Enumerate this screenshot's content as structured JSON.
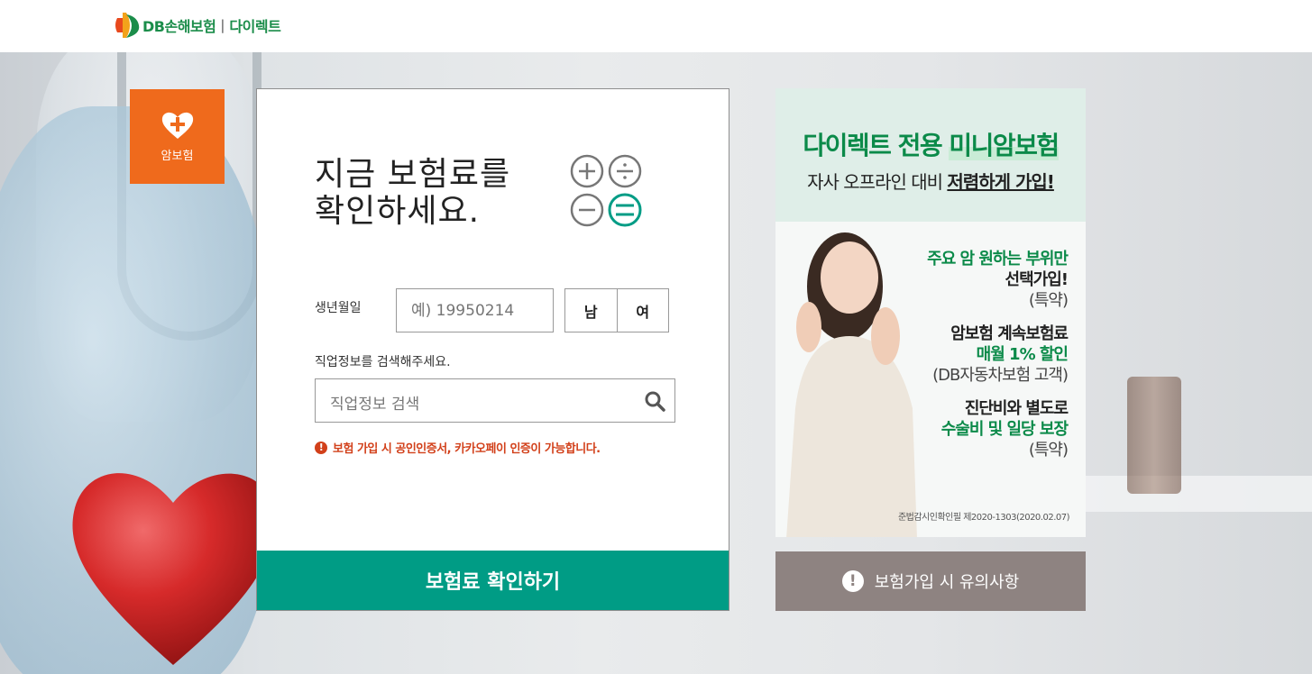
{
  "header": {
    "logo_text": "DB손해보험",
    "logo_sub": "다이렉트"
  },
  "product_tab": {
    "label": "암보험"
  },
  "form": {
    "title_line1": "지금 보험료를",
    "title_line2": "확인하세요.",
    "birth_label": "생년월일",
    "birth_placeholder": "예) 19950214",
    "gender_male": "남",
    "gender_female": "여",
    "job_label": "직업정보를 검색해주세요.",
    "job_placeholder": "직업정보 검색",
    "notice": "보험 가입 시 공인인증서, 카카오페이 인증이 가능합니다.",
    "submit_label": "보험료 확인하기"
  },
  "banner": {
    "headline_part1": "다이렉트 전용 ",
    "headline_part2": "미니암보험",
    "sub_part1": "자사 오프라인 대비 ",
    "sub_part2": "저렴하게 가입!",
    "blocks": [
      {
        "l1": "주요 암 원하는 부위만",
        "l2": "선택가입!",
        "l3": "(특약)"
      },
      {
        "l1": "암보험 계속보험료",
        "l2": "매월 1% 할인",
        "l3": "(DB자동차보험 고객)"
      },
      {
        "l1": "진단비와 별도로",
        "l2": "수술비 및 일당 보장",
        "l3": "(특약)"
      }
    ],
    "legal": "준법감시인확인필 제2020-1303(2020.02.07)"
  },
  "caution_button": {
    "label": "보험가입 시 유의사항"
  },
  "colors": {
    "brand_green": "#009c85",
    "tab_orange": "#ef6a1c",
    "notice_red": "#d2401a",
    "caution_gray": "#8e8381"
  }
}
